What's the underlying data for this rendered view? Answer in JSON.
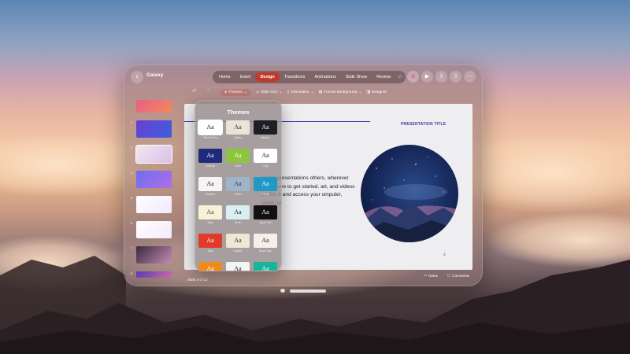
{
  "window": {
    "title": "Galaxy"
  },
  "tabs": [
    {
      "label": "Home",
      "active": false
    },
    {
      "label": "Insert",
      "active": false
    },
    {
      "label": "Design",
      "active": true
    },
    {
      "label": "Transitions",
      "active": false
    },
    {
      "label": "Animations",
      "active": false
    },
    {
      "label": "Slide Show",
      "active": false
    },
    {
      "label": "Review",
      "active": false
    },
    {
      "label": "Vi",
      "active": false
    }
  ],
  "top_actions": [
    "copilot-icon",
    "play-icon",
    "share-icon",
    "export-icon",
    "more-icon"
  ],
  "toolbar": {
    "themes": "Themes",
    "slide_size": "Slide Size",
    "orientation": "Orientation",
    "format_background": "Format Background",
    "designer": "Designer"
  },
  "slide": {
    "pres_title": "PRESENTATION TITLE",
    "headline": "on",
    "body": "create presentations others, wherever they t here to get started. art, and videos on this e and access your omputer, tablet, or",
    "page_number": "3"
  },
  "status": {
    "slide": "Slide 3 of 13",
    "notes": "Notes",
    "comments": "Comments"
  },
  "themes_panel": {
    "title": "Themes",
    "themes": [
      {
        "name": "Office Theme",
        "aa": "Aa",
        "bg": "#ffffff",
        "fg": "#222222",
        "selected": true
      },
      {
        "name": "Gallery",
        "aa": "Aa",
        "bg": "#e9e3da",
        "fg": "#3a2e22",
        "selected": false
      },
      {
        "name": "Madison",
        "aa": "Aa",
        "bg": "#1c1f24",
        "fg": "#ffffff",
        "selected": false
      },
      {
        "name": "Celestial",
        "aa": "Aa",
        "bg": "#1e2b7a",
        "fg": "#ffffff",
        "selected": false
      },
      {
        "name": "Facet",
        "aa": "Aa",
        "bg": "#8cc63f",
        "fg": "#ffffff",
        "selected": false
      },
      {
        "name": "Crop",
        "aa": "Aa",
        "bg": "#ffffff",
        "fg": "#222222",
        "selected": false
      },
      {
        "name": "Dividend",
        "aa": "Aa",
        "bg": "#f4f4f4",
        "fg": "#222222",
        "selected": false
      },
      {
        "name": "Parcel",
        "aa": "Aa",
        "bg": "#9fb4c7",
        "fg": "#2f3b4a",
        "selected": false
      },
      {
        "name": "Circuit",
        "aa": "Aa",
        "bg": "#1f9ac8",
        "fg": "#ffffff",
        "selected": false
      },
      {
        "name": "Wisp",
        "aa": "Aa",
        "bg": "#f7f1d7",
        "fg": "#4a3f22",
        "selected": false
      },
      {
        "name": "Berlin",
        "aa": "Aa",
        "bg": "#d9f0f2",
        "fg": "#222222",
        "selected": false
      },
      {
        "name": "Vapor Trail",
        "aa": "Aa",
        "bg": "#111111",
        "fg": "#ffffff",
        "selected": false
      },
      {
        "name": "Atlas",
        "aa": "Aa",
        "bg": "#e23a2a",
        "fg": "#ffffff",
        "selected": false
      },
      {
        "name": "Organic",
        "aa": "Aa",
        "bg": "#efe6d4",
        "fg": "#3a2e22",
        "selected": false
      },
      {
        "name": "Wood Type",
        "aa": "Aa",
        "bg": "#f3f0ea",
        "fg": "#222222",
        "selected": false
      },
      {
        "name": "",
        "aa": "Aa",
        "bg": "#f08a1c",
        "fg": "#ffffff",
        "selected": false
      },
      {
        "name": "",
        "aa": "Aa",
        "bg": "#f4f4f4",
        "fg": "#222222",
        "selected": false
      },
      {
        "name": "",
        "aa": "Aa",
        "bg": "#18b59a",
        "fg": "#ffffff",
        "selected": false
      }
    ]
  },
  "thumbnails": [
    {
      "num": "1",
      "colors": [
        "#e85b8a",
        "#f08a5d"
      ]
    },
    {
      "num": "2",
      "colors": [
        "#6a3fd0",
        "#3b5fe0"
      ]
    },
    {
      "num": "3",
      "colors": [
        "#f3e6ef",
        "#d8c0e6"
      ]
    },
    {
      "num": "4",
      "colors": [
        "#6c6ef0",
        "#b06ee8"
      ]
    },
    {
      "num": "5",
      "colors": [
        "#ffffff",
        "#f1e8ff"
      ]
    },
    {
      "num": "6",
      "colors": [
        "#ffffff",
        "#f3eaf6"
      ]
    },
    {
      "num": "7",
      "colors": [
        "#3a2a40",
        "#c48cb0"
      ]
    },
    {
      "num": "8",
      "colors": [
        "#5a3ab0",
        "#e67aa8"
      ]
    }
  ]
}
